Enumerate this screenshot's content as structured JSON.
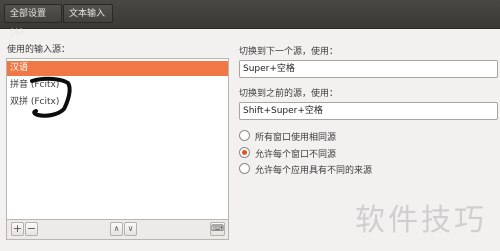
{
  "toolbar": {
    "all_settings": "全部设置(A)",
    "text_entry": "文本输入"
  },
  "sources": {
    "label": "使用的输入源：",
    "items": [
      {
        "label": "汉语",
        "selected": true
      },
      {
        "label": "拼音 (Fcitx)",
        "selected": false
      },
      {
        "label": "双拼 (Fcitx)",
        "selected": false
      }
    ],
    "buttons": {
      "add": "+",
      "remove": "−",
      "up": "∧",
      "down": "∨",
      "keyboard": "⌨"
    }
  },
  "settings": {
    "next_label": "切换到下一个源，使用：",
    "next_value": "Super+空格",
    "prev_label": "切换到之前的源，使用：",
    "prev_value": "Shift+Super+空格",
    "radios": [
      {
        "label": "所有窗口使用相同源",
        "checked": false
      },
      {
        "label": "允许每个窗口不同源",
        "checked": true
      },
      {
        "label": "允许每个应用具有不同的来源",
        "checked": false
      }
    ]
  },
  "watermark": "软件技巧",
  "colors": {
    "selection": "#f07746",
    "toolbar": "#3c3b37",
    "radio_dot": "#e9501e"
  }
}
